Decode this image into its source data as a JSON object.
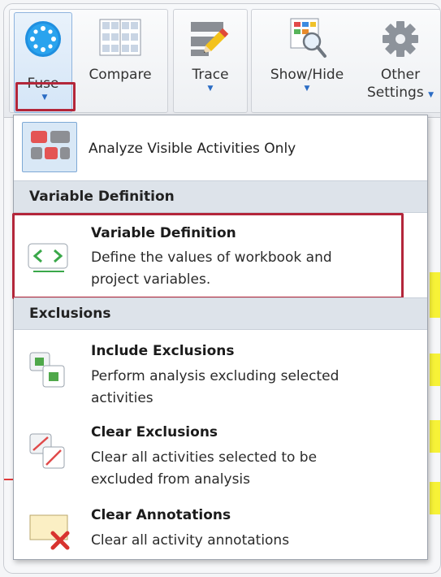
{
  "ribbon": {
    "fuse": {
      "label": "Fuse",
      "icon": "fuse-icon"
    },
    "compare": {
      "label": "Compare",
      "icon": "compare-grid-icon"
    },
    "trace": {
      "label": "Trace",
      "icon": "pencil-icon"
    },
    "show_hide": {
      "label": "Show/Hide",
      "icon": "show-hide-icon"
    },
    "other_settings": {
      "label_line1": "Other",
      "label_line2": "Settings",
      "icon": "gear-icon"
    }
  },
  "menu": {
    "top_item": {
      "label": "Analyze Visible Activities Only",
      "icon": "analyze-visible-icon"
    },
    "sections": [
      {
        "header": "Variable Definition",
        "items": [
          {
            "title": "Variable Definition",
            "desc_line1": "Define the values of workbook and",
            "desc_line2": "project variables.",
            "icon": "variable-definition-icon"
          }
        ]
      },
      {
        "header": "Exclusions",
        "items": [
          {
            "title": "Include Exclusions",
            "desc_line1": "Perform analysis excluding selected",
            "desc_line2": "activities",
            "icon": "include-exclusions-icon"
          },
          {
            "title": "Clear Exclusions",
            "desc_line1": "Clear all activities selected to be",
            "desc_line2": "excluded from analysis",
            "icon": "clear-exclusions-icon"
          },
          {
            "title": "Clear Annotations",
            "desc_line1": "Clear all activity annotations",
            "icon": "clear-annotations-icon"
          }
        ]
      }
    ]
  },
  "colors": {
    "highlight_box": "#b3263a",
    "section_header_bg": "#dde3ea",
    "accent_blue": "#2b6cc4"
  }
}
